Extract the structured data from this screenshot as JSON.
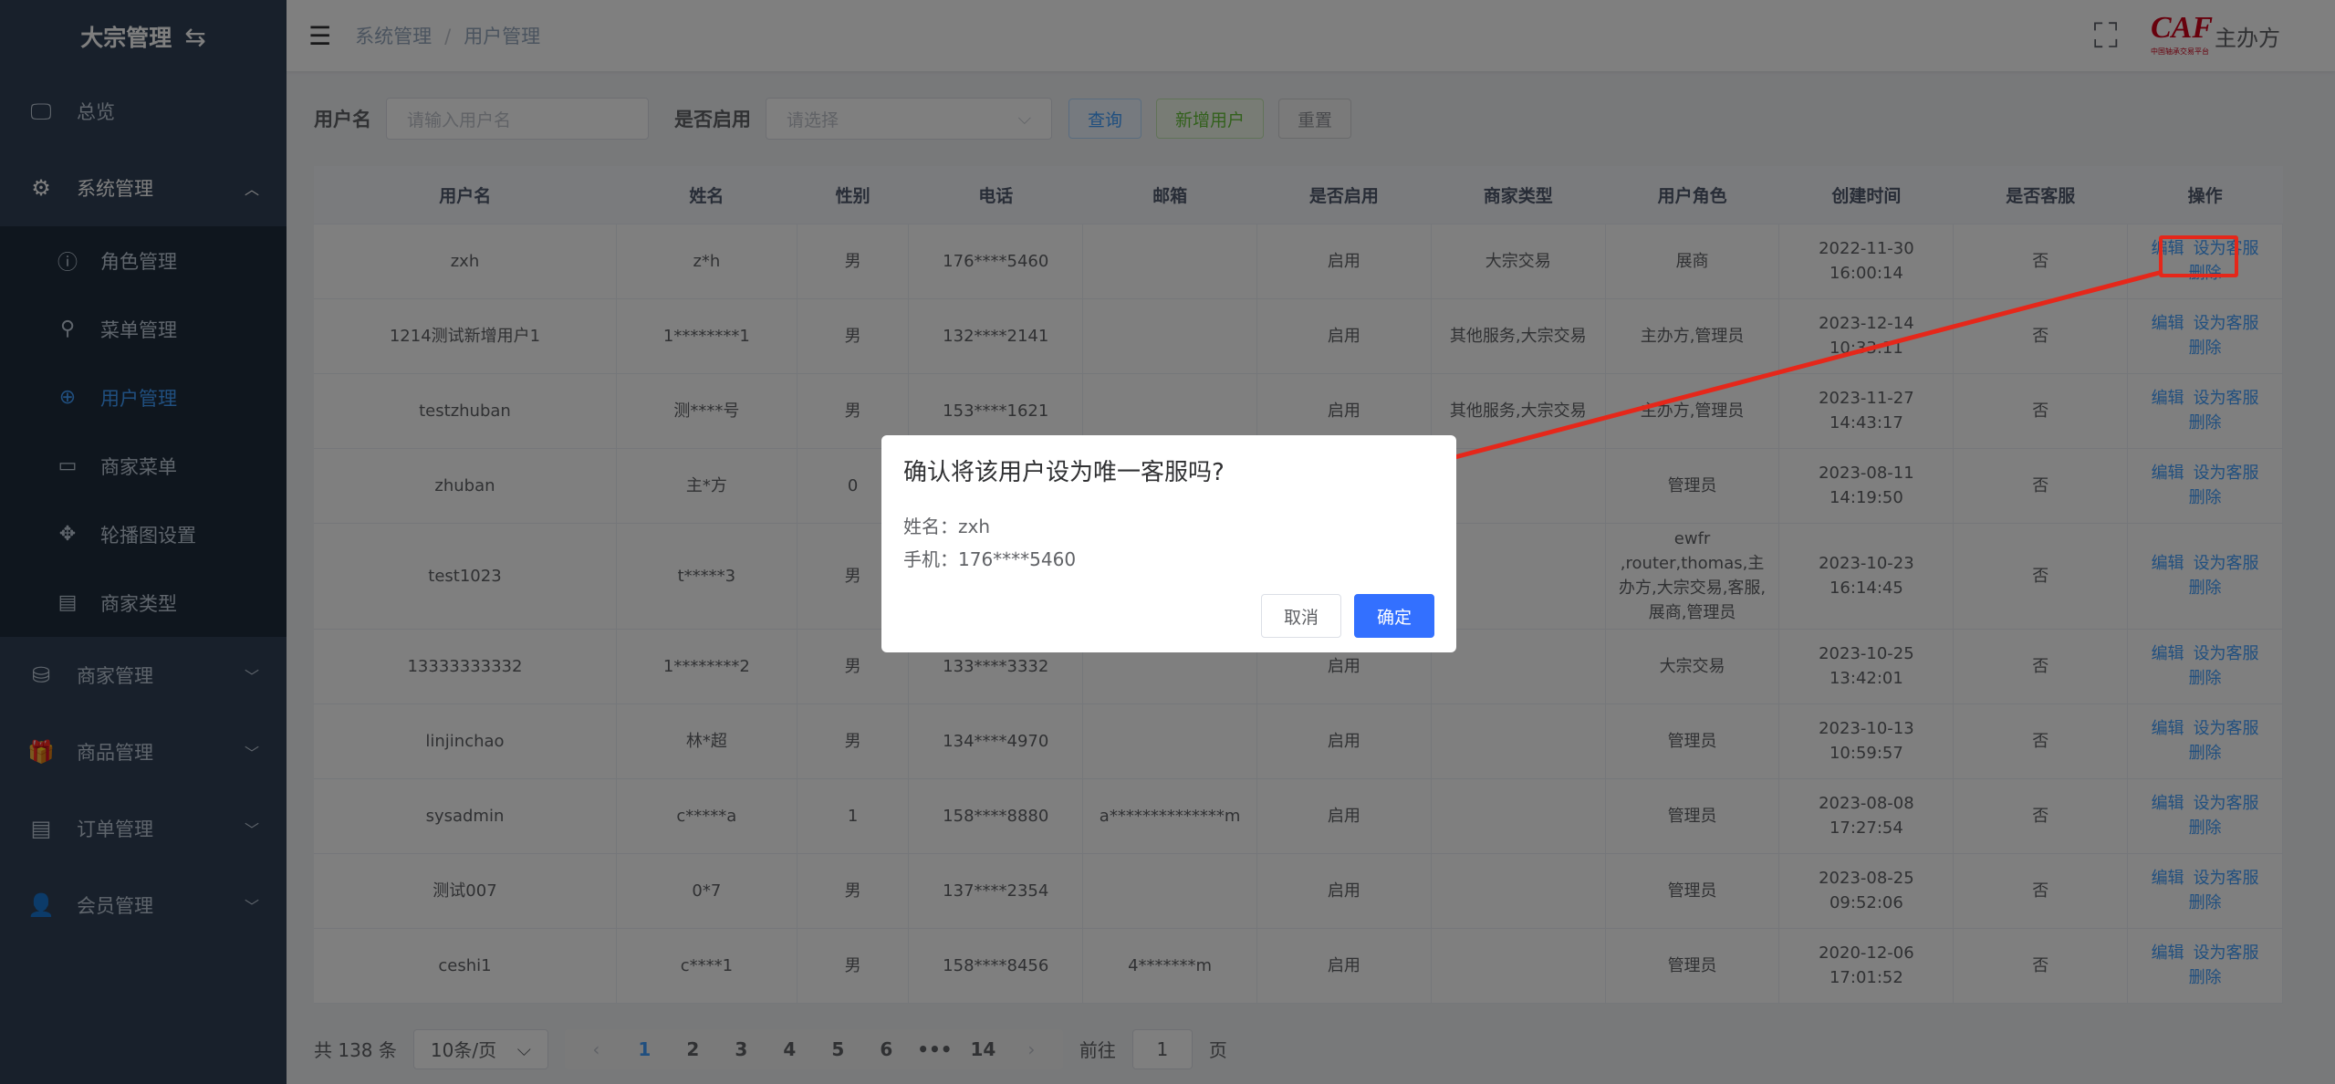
{
  "app": {
    "title": "大宗管理",
    "swap_icon": "⇆"
  },
  "sidebar": {
    "overview": "总览",
    "system": "系统管理",
    "sub": [
      {
        "label": "角色管理",
        "icon": "ⓘ"
      },
      {
        "label": "菜单管理",
        "icon": "⚲"
      },
      {
        "label": "用户管理",
        "icon": "⊕"
      },
      {
        "label": "商家菜单",
        "icon": "▭"
      },
      {
        "label": "轮播图设置",
        "icon": "✥"
      },
      {
        "label": "商家类型",
        "icon": "▤"
      }
    ],
    "merchant": "商家管理",
    "goods": "商品管理",
    "orders": "订单管理",
    "members": "会员管理"
  },
  "header": {
    "crumb_parent": "系统管理",
    "crumb_sep": "/",
    "crumb_current": "用户管理",
    "logo_text": "CAF",
    "logo_caption": "中国轴承交易平台",
    "org": "主办方"
  },
  "filters": {
    "username_label": "用户名",
    "username_placeholder": "请输入用户名",
    "enabled_label": "是否启用",
    "enabled_placeholder": "请选择",
    "query": "查询",
    "add": "新增用户",
    "reset": "重置"
  },
  "table": {
    "headers": [
      "用户名",
      "姓名",
      "性别",
      "电话",
      "邮箱",
      "是否启用",
      "商家类型",
      "用户角色",
      "创建时间",
      "是否客服",
      "操作"
    ],
    "actions": {
      "edit": "编辑",
      "set_cs": "设为客服",
      "delete": "删除"
    },
    "rows": [
      [
        "zxh",
        "z*h",
        "男",
        "176****5460",
        "",
        "启用",
        "大宗交易",
        "展商",
        "2022-11-30 16:00:14",
        "否"
      ],
      [
        "1214测试新增用户1",
        "1********1",
        "男",
        "132****2141",
        "",
        "启用",
        "其他服务,大宗交易",
        "主办方,管理员",
        "2023-12-14 10:33:11",
        "否"
      ],
      [
        "testzhuban",
        "测****号",
        "男",
        "153****1621",
        "",
        "启用",
        "其他服务,大宗交易",
        "主办方,管理员",
        "2023-11-27 14:43:17",
        "否"
      ],
      [
        "zhuban",
        "主*方",
        "0",
        "",
        "",
        "",
        "",
        "管理员",
        "2023-08-11 14:19:50",
        "否"
      ],
      [
        "test1023",
        "t*****3",
        "男",
        "",
        "",
        "",
        "",
        "ewfr ,router,thomas,主办方,大宗交易,客服,展商,管理员",
        "2023-10-23 16:14:45",
        "否"
      ],
      [
        "13333333332",
        "1********2",
        "男",
        "133****3332",
        "",
        "启用",
        "",
        "大宗交易",
        "2023-10-25 13:42:01",
        "否"
      ],
      [
        "linjinchao",
        "林*超",
        "男",
        "134****4970",
        "",
        "启用",
        "",
        "管理员",
        "2023-10-13 10:59:57",
        "否"
      ],
      [
        "sysadmin",
        "c*****a",
        "1",
        "158****8880",
        "a**************m",
        "启用",
        "",
        "管理员",
        "2023-08-08 17:27:54",
        "否"
      ],
      [
        "测试007",
        "0*7",
        "男",
        "137****2354",
        "",
        "启用",
        "",
        "管理员",
        "2023-08-25 09:52:06",
        "否"
      ],
      [
        "ceshi1",
        "c****1",
        "男",
        "158****8456",
        "4*******m",
        "启用",
        "",
        "管理员",
        "2020-12-06 17:01:52",
        "否"
      ]
    ]
  },
  "pager": {
    "total": "共 138 条",
    "size": "10条/页",
    "pages": [
      "1",
      "2",
      "3",
      "4",
      "5",
      "6",
      "•••",
      "14"
    ],
    "goto_label": "前往",
    "goto_value": "1",
    "goto_suffix": "页"
  },
  "dialog": {
    "title": "确认将该用户设为唯一客服吗?",
    "name_line": "姓名：zxh",
    "phone_line": "手机：176****5460",
    "cancel": "取消",
    "confirm": "确定"
  },
  "colors": {
    "sidebar": "#304156",
    "active": "#409eff",
    "annotation": "#e5271a",
    "confirm": "#3370ff"
  }
}
